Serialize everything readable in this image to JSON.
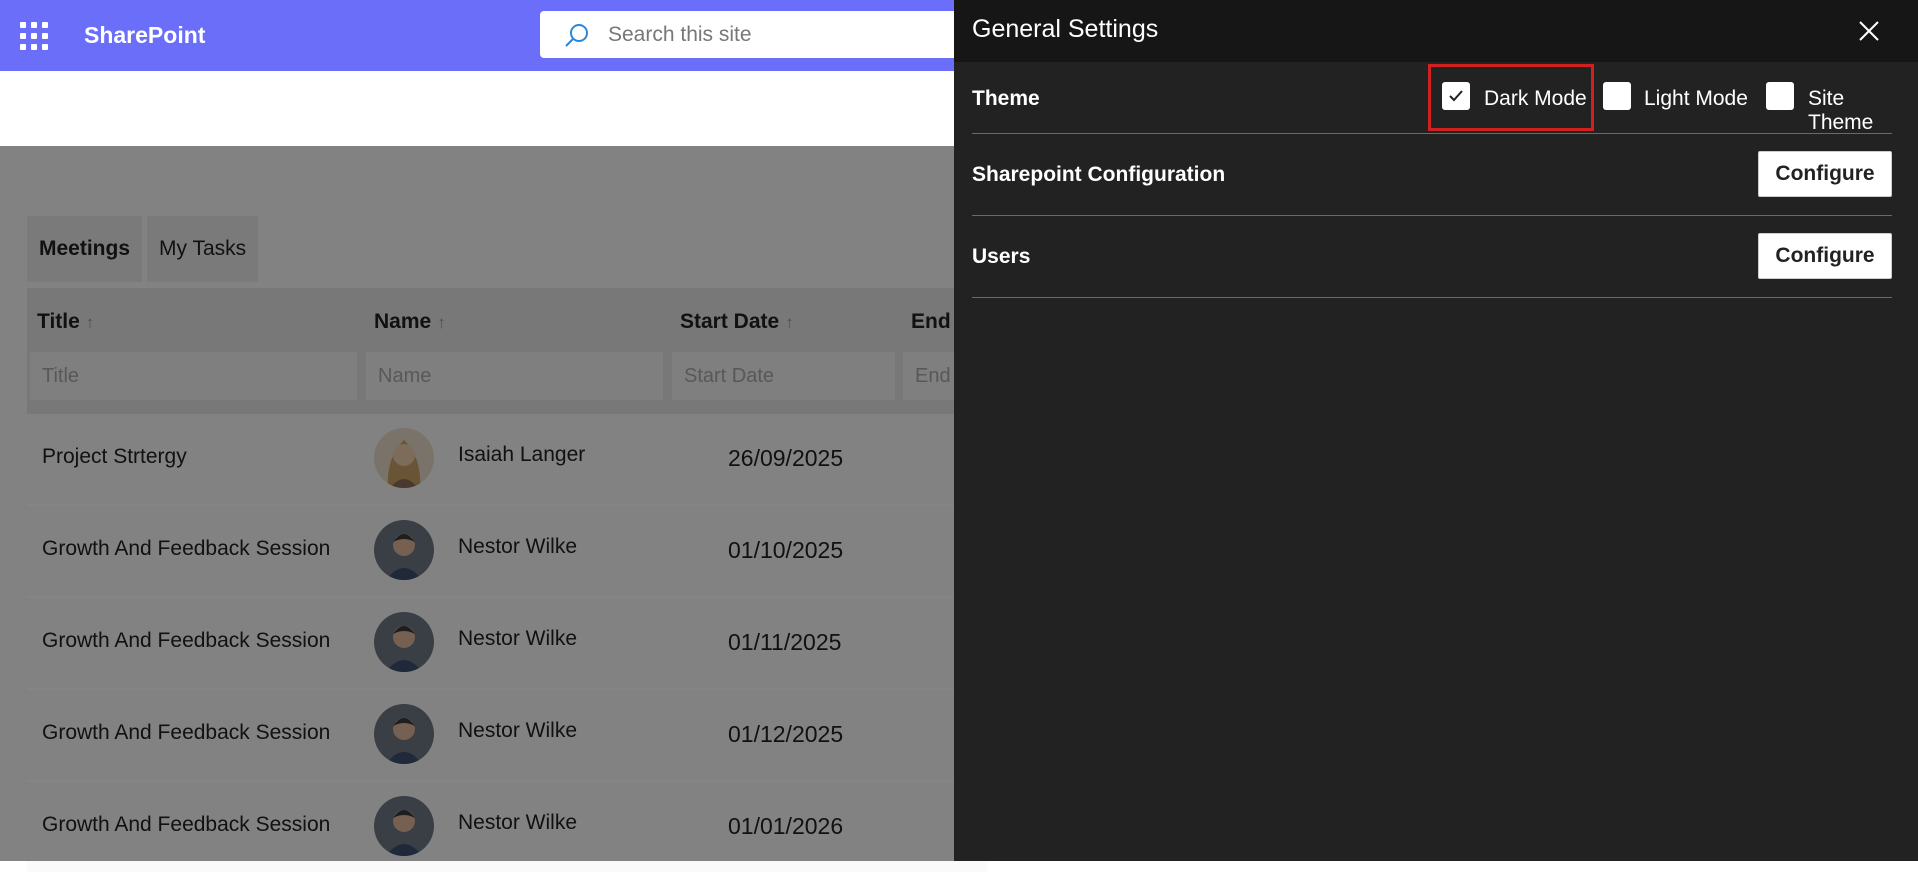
{
  "suitebar": {
    "brand": "SharePoint",
    "search_placeholder": "Search this site",
    "bg_color": "#6b6ef9"
  },
  "tabs": [
    {
      "label": "Meetings",
      "active": true
    },
    {
      "label": "My Tasks",
      "active": false
    }
  ],
  "grid": {
    "columns": [
      {
        "label": "Title",
        "sort_icon": "arrow-up-icon",
        "filter_placeholder": "Title"
      },
      {
        "label": "Name",
        "sort_icon": "arrow-up-icon",
        "filter_placeholder": "Name"
      },
      {
        "label": "Start Date",
        "sort_icon": "arrow-up-icon",
        "filter_placeholder": "Start Date"
      },
      {
        "label": "End",
        "filter_placeholder": "End"
      }
    ],
    "rows": [
      {
        "title": "Project Strtergy",
        "name": "Isaiah Langer",
        "start": "26/09/2025",
        "avatar": "woman-avatar"
      },
      {
        "title": "Growth And Feedback Session",
        "name": "Nestor Wilke",
        "start": "01/10/2025",
        "avatar": "man-avatar"
      },
      {
        "title": "Growth And Feedback Session",
        "name": "Nestor Wilke",
        "start": "01/11/2025",
        "avatar": "man-avatar"
      },
      {
        "title": "Growth And Feedback Session",
        "name": "Nestor Wilke",
        "start": "01/12/2025",
        "avatar": "man-avatar"
      },
      {
        "title": "Growth And Feedback Session",
        "name": "Nestor Wilke",
        "start": "01/01/2026",
        "avatar": "man-avatar"
      }
    ]
  },
  "panel": {
    "title": "General Settings",
    "close_icon": "close-icon",
    "theme": {
      "label": "Theme",
      "options": [
        {
          "label": "Dark Mode",
          "checked": true
        },
        {
          "label": "Light Mode",
          "checked": false
        },
        {
          "label": "Site Theme",
          "checked": false
        }
      ],
      "highlight_color": "#d21f1f"
    },
    "sharepoint_config": {
      "label": "Sharepoint Configuration",
      "button": "Configure"
    },
    "users": {
      "label": "Users",
      "button": "Configure"
    }
  }
}
